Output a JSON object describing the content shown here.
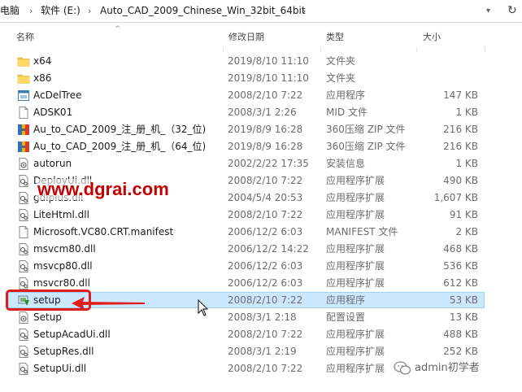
{
  "address_bar": {
    "crumbs": [
      "电脑",
      "软件 (E:)",
      "Auto_CAD_2009_Chinese_Win_32bit_64bit"
    ]
  },
  "columns": {
    "name": "名称",
    "date": "修改日期",
    "type": "类型",
    "size": "大小"
  },
  "files": [
    {
      "icon": "folder-icon",
      "name": "x64",
      "date": "2019/8/10 11:10",
      "type": "文件夹",
      "size": ""
    },
    {
      "icon": "folder-icon",
      "name": "x86",
      "date": "2019/8/10 11:10",
      "type": "文件夹",
      "size": ""
    },
    {
      "icon": "app-icon",
      "name": "AcDelTree",
      "date": "2008/2/10 7:22",
      "type": "应用程序",
      "size": "147 KB"
    },
    {
      "icon": "file-icon",
      "name": "ADSK01",
      "date": "2008/3/1 2:26",
      "type": "MID 文件",
      "size": "1 KB"
    },
    {
      "icon": "archive-icon",
      "name": "Au_to_CAD_2009_注_册_机_（32_位)",
      "date": "2019/8/9 16:28",
      "type": "360压缩 ZIP 文件",
      "size": "216 KB"
    },
    {
      "icon": "archive-icon",
      "name": "Au_to_CAD_2009_注_册_机_（64_位)",
      "date": "2019/8/9 16:28",
      "type": "360压缩 ZIP 文件",
      "size": "216 KB"
    },
    {
      "icon": "settings-file-icon",
      "name": "autorun",
      "date": "2002/2/22 17:35",
      "type": "安装信息",
      "size": "1 KB"
    },
    {
      "icon": "dll-icon",
      "name": "DeployUi.dll",
      "date": "2008/2/10 7:22",
      "type": "应用程序扩展",
      "size": "490 KB"
    },
    {
      "icon": "dll-icon",
      "name": "gdiplus.dll",
      "date": "2004/5/4 20:53",
      "type": "应用程序扩展",
      "size": "1,607 KB"
    },
    {
      "icon": "dll-icon",
      "name": "LiteHtml.dll",
      "date": "2008/2/10 7:22",
      "type": "应用程序扩展",
      "size": "91 KB"
    },
    {
      "icon": "file-icon",
      "name": "Microsoft.VC80.CRT.manifest",
      "date": "2006/12/2 6:03",
      "type": "MANIFEST 文件",
      "size": "2 KB"
    },
    {
      "icon": "dll-icon",
      "name": "msvcm80.dll",
      "date": "2006/12/2 14:22",
      "type": "应用程序扩展",
      "size": "468 KB"
    },
    {
      "icon": "dll-icon",
      "name": "msvcp80.dll",
      "date": "2006/12/2 6:03",
      "type": "应用程序扩展",
      "size": "536 KB"
    },
    {
      "icon": "dll-icon",
      "name": "msvcr80.dll",
      "date": "2006/12/2 6:03",
      "type": "应用程序扩展",
      "size": "612 KB"
    },
    {
      "icon": "setup-icon",
      "name": "setup",
      "date": "2008/2/10 7:22",
      "type": "应用程序",
      "size": "53 KB",
      "selected": true
    },
    {
      "icon": "settings-file-icon",
      "name": "Setup",
      "date": "2008/3/1 2:18",
      "type": "配置设置",
      "size": "13 KB"
    },
    {
      "icon": "dll-icon",
      "name": "SetupAcadUi.dll",
      "date": "2008/2/10 7:22",
      "type": "应用程序扩展",
      "size": "488 KB"
    },
    {
      "icon": "dll-icon",
      "name": "SetupRes.dll",
      "date": "2008/3/1 2:19",
      "type": "应用程序扩展",
      "size": "252 KB"
    },
    {
      "icon": "dll-icon",
      "name": "SetupUi.dll",
      "date": "2008/2/10 7:22",
      "type": "应用程序扩展",
      "size": ""
    }
  ],
  "watermark": "www.dgrai.com",
  "wechat_watermark": "admin初学者",
  "colors": {
    "selection_bg": "#cce8ff",
    "selection_border": "#99d1ff",
    "callout": "#e21b1b",
    "watermark": "#c40000",
    "folder": "#f5c74a"
  }
}
